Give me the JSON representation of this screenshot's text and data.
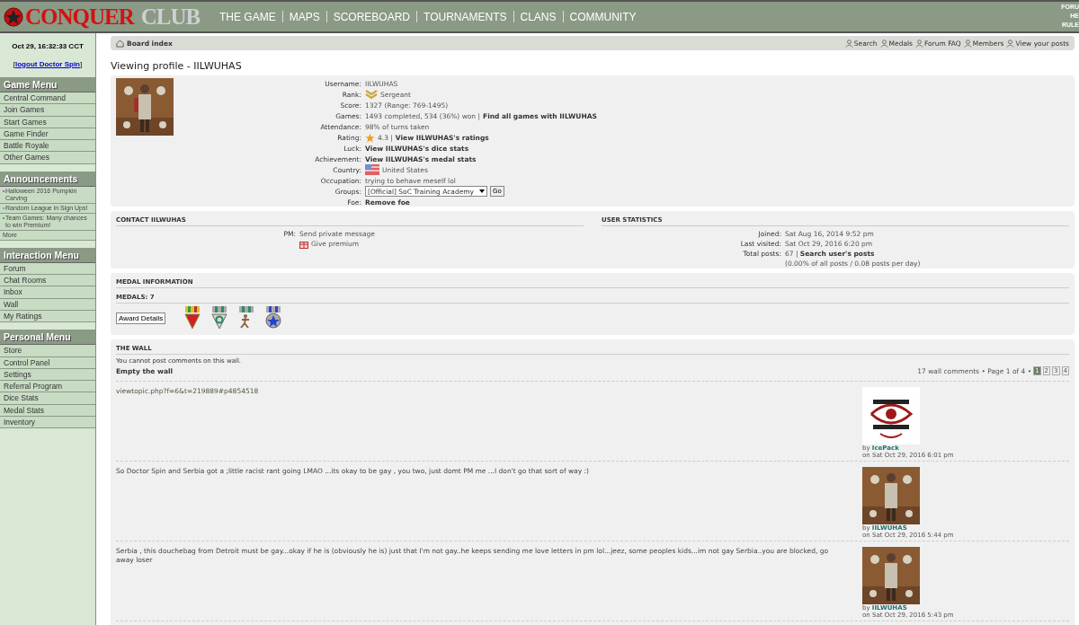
{
  "logo": {
    "word1": "CONQUER",
    "word2": "CLUB"
  },
  "nav": [
    "THE GAME",
    "MAPS",
    "SCOREBOARD",
    "TOURNAMENTS",
    "CLANS",
    "COMMUNITY"
  ],
  "top_right_links": [
    "FORU",
    "HE",
    "RULE"
  ],
  "sidebar": {
    "clock": "Oct 29, 16:32:33 CCT",
    "logout": {
      "prefix": "[",
      "link": "logout Doctor Spin",
      "suffix": "]"
    },
    "sections": [
      {
        "title": "Game Menu",
        "kind": "menu",
        "items": [
          {
            "label": "Central Command"
          },
          {
            "label": "Join Games"
          },
          {
            "label": "Start Games"
          },
          {
            "label": "Game Finder"
          },
          {
            "label": "Battle Royale"
          },
          {
            "label": "Other Games"
          }
        ]
      },
      {
        "title": "Announcements",
        "kind": "news",
        "items": [
          {
            "label": "Halloween 2016 Pumpkin Carving",
            "color": "#e040e0"
          },
          {
            "label": "Random League in Sign Ups!",
            "color": "#40c0c0"
          },
          {
            "label": "Team Games: Many chances to win Premium!",
            "color": "#40b040"
          },
          {
            "label": "More"
          }
        ]
      },
      {
        "title": "Interaction Menu",
        "kind": "menu",
        "items": [
          {
            "label": "Forum"
          },
          {
            "label": "Chat Rooms"
          },
          {
            "label": "Inbox"
          },
          {
            "label": "Wall"
          },
          {
            "label": "My Ratings"
          }
        ]
      },
      {
        "title": "Personal Menu",
        "kind": "menu",
        "items": [
          {
            "label": "Store"
          },
          {
            "label": "Control Panel"
          },
          {
            "label": "Settings"
          },
          {
            "label": "Referral Program"
          },
          {
            "label": "Dice Stats"
          },
          {
            "label": "Medal Stats"
          },
          {
            "label": "Inventory"
          }
        ]
      }
    ]
  },
  "breadcrumb": "Board index",
  "quick_links": [
    "Search",
    "Medals",
    "Forum FAQ",
    "Members",
    "View your posts"
  ],
  "page_title": "Viewing profile - IILWUHAS",
  "profile": [
    {
      "label": "Username:",
      "kind": "text",
      "value": "IILWUHAS"
    },
    {
      "label": "Rank:",
      "kind": "rank",
      "value": "Sergeant"
    },
    {
      "label": "Score:",
      "kind": "text",
      "value": "1327 (Range: 769-1495)"
    },
    {
      "label": "Games:",
      "kind": "text",
      "value": "1493 completed, 534 (36%) won |",
      "link": "Find all games with IILWUHAS"
    },
    {
      "label": "Attendance:",
      "kind": "text",
      "value": "98% of turns taken"
    },
    {
      "label": "Rating:",
      "kind": "rating",
      "value": "4.3 |",
      "link": "View IILWUHAS's ratings"
    },
    {
      "label": "Luck:",
      "kind": "text",
      "link": "View IILWUHAS's dice stats"
    },
    {
      "label": "Achievement:",
      "kind": "text",
      "link": "View IILWUHAS's medal stats"
    },
    {
      "label": "Country:",
      "kind": "country",
      "value": "United States"
    },
    {
      "label": "Occupation:",
      "kind": "text",
      "value": "trying to behave meself lol"
    },
    {
      "label": "Groups:",
      "kind": "select",
      "value": "[Official] SoC Training Academy",
      "button": "Go"
    },
    {
      "label": "Foe:",
      "kind": "text",
      "link": "Remove foe"
    }
  ],
  "contact": {
    "title": "CONTACT IILWUHAS",
    "pm_label": "PM:",
    "pm_link": "Send private message",
    "premium_link": "Give premium"
  },
  "user_statistics": {
    "title": "USER STATISTICS",
    "rows": [
      {
        "label": "Joined:",
        "value": "Sat Aug 16, 2014 9:52 pm"
      },
      {
        "label": "Last visited:",
        "value": "Sat Oct 29, 2016 6:20 pm"
      },
      {
        "label": "Total posts:",
        "value": "67 |",
        "link": "Search user's posts",
        "note": "(0.00% of all posts / 0.08 posts per day)"
      }
    ]
  },
  "medals": {
    "title": "MEDAL INFORMATION",
    "count": "MEDALS: 7",
    "button": "Award Details"
  },
  "wall": {
    "title": "THE WALL",
    "notice": "You cannot post comments on this wall.",
    "empty_link": "Empty the wall",
    "summary": "17 wall comments • Page 1 of 4 •",
    "pages": [
      {
        "label": "1",
        "selected": true
      },
      {
        "label": "2",
        "selected": false
      },
      {
        "label": "3",
        "selected": false
      },
      {
        "label": "4",
        "selected": false
      }
    ],
    "posts": [
      {
        "kind": "link",
        "text": "viewtopic.php?f=6&t=219889#p4854518",
        "by": "by",
        "author": "IcePack",
        "date": "on Sat Oct 29, 2016 6:01 pm"
      },
      {
        "kind": "text",
        "text": "So Doctor Spin and Serbia got a ;little racist rant going LMAO ...its okay to be gay , you two, just domt PM me ...I don't go that sort of way :)",
        "by": "by",
        "author": "IILWUHAS",
        "date": "on Sat Oct 29, 2016 5:44 pm"
      },
      {
        "kind": "text",
        "text": "Serbia , this douchebag from Detroit must be gay...okay if he is (obviously he is) just that I'm not gay..he keeps sending me love letters in pm lol...jeez, some peoples kids...im not gay Serbia..you are blocked, go away loser",
        "by": "by",
        "author": "IILWUHAS",
        "date": "on Sat Oct 29, 2016 5:43 pm"
      }
    ]
  }
}
